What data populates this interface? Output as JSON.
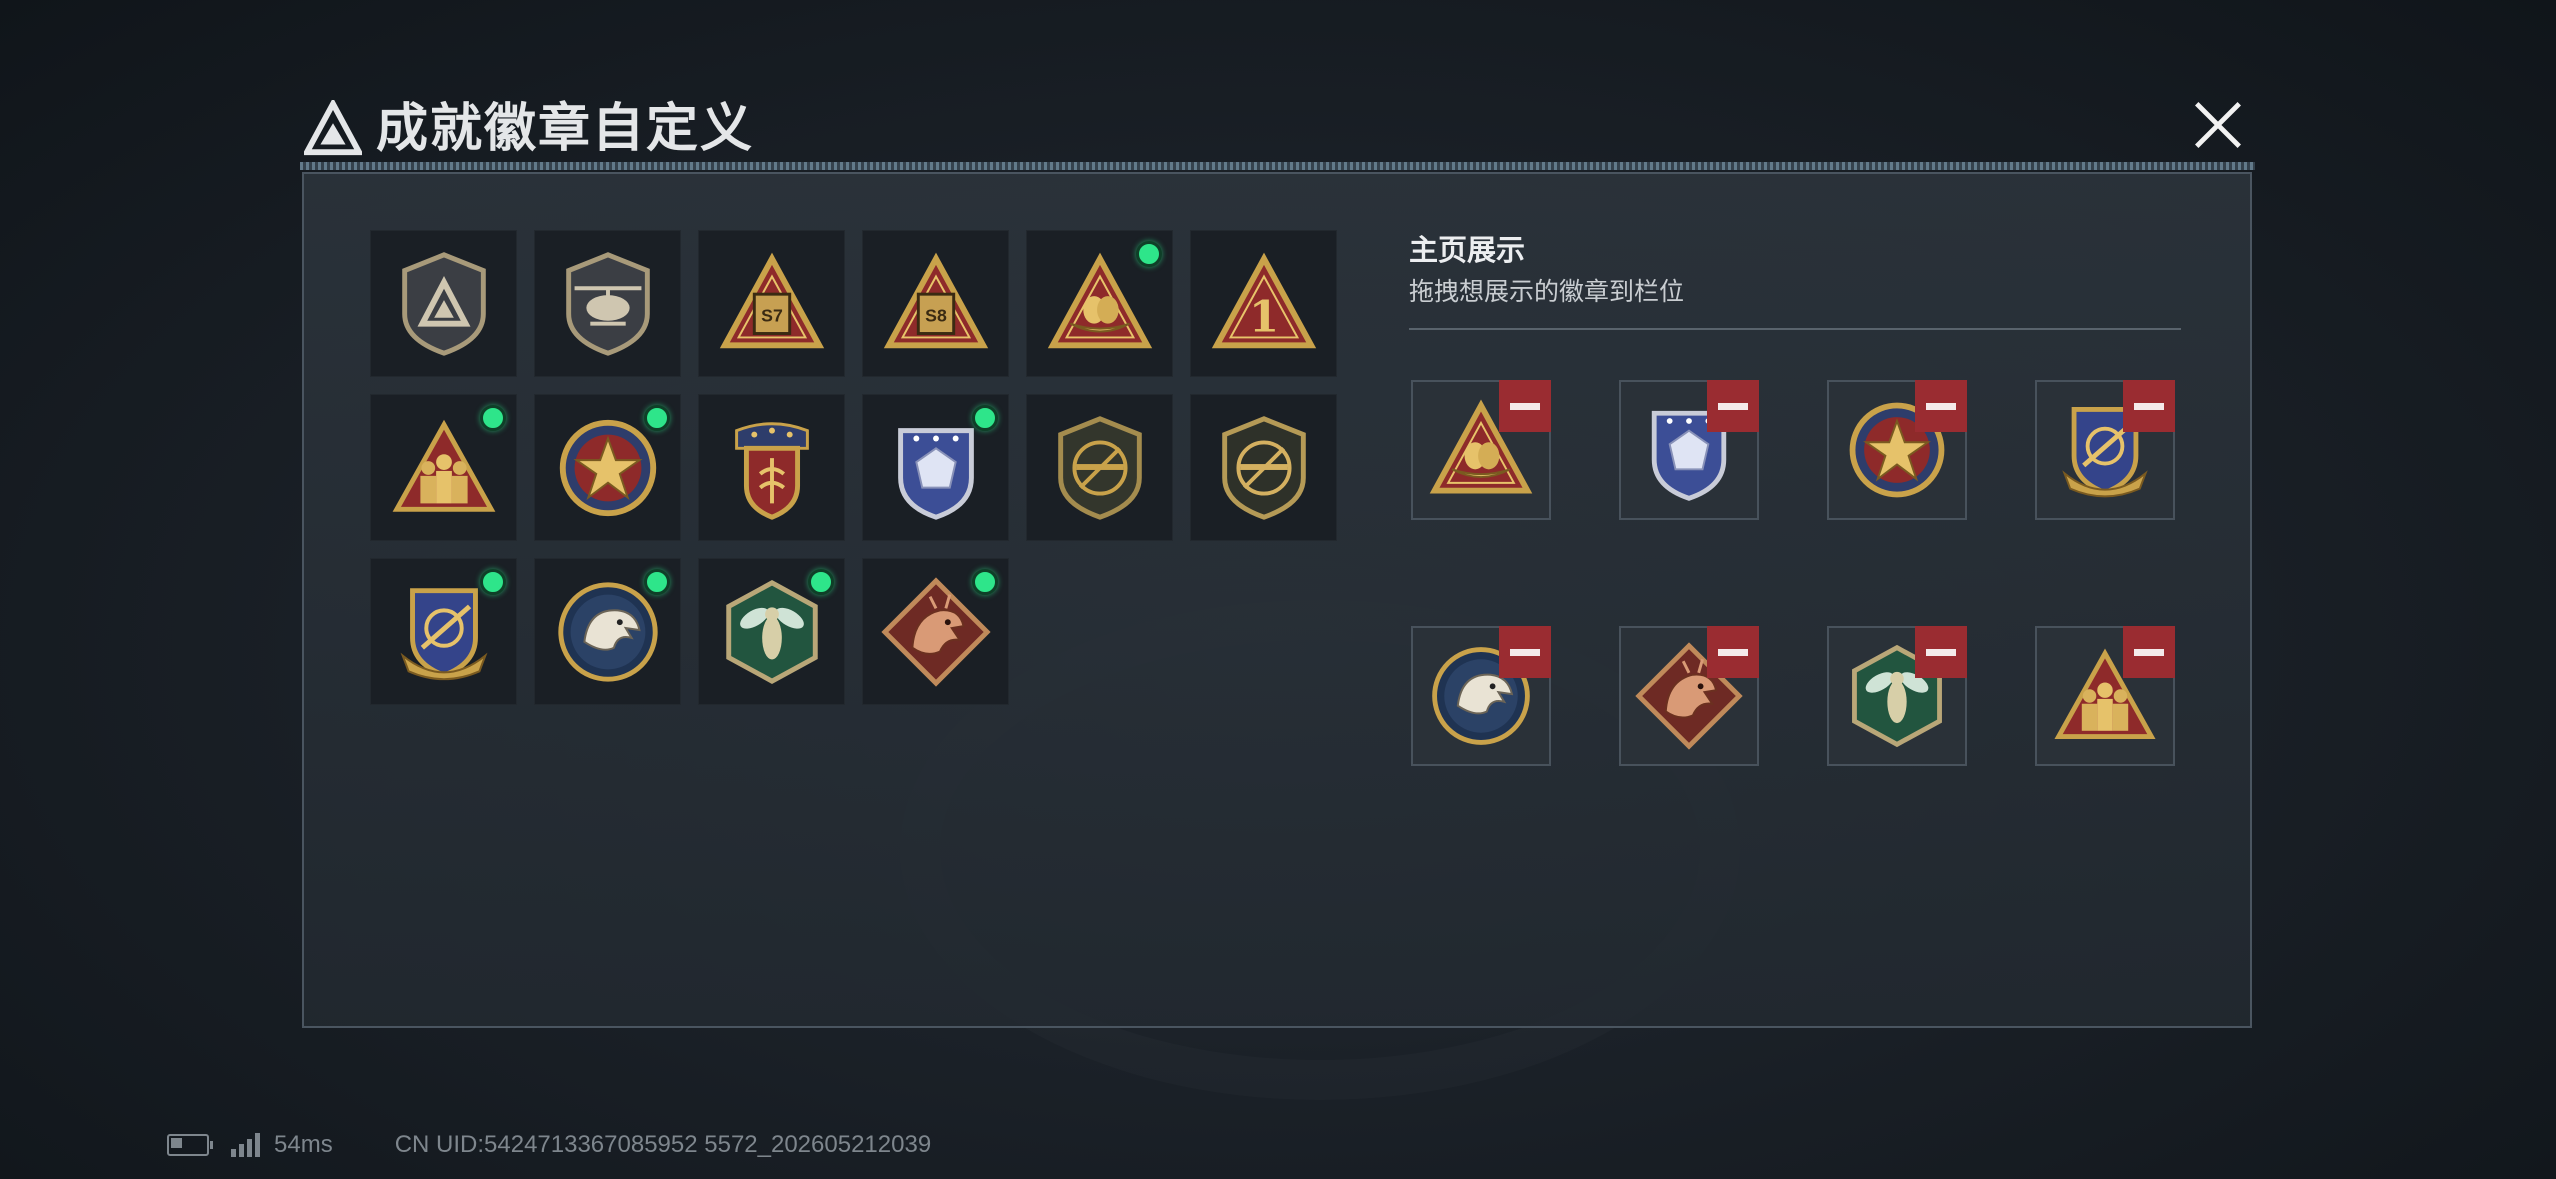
{
  "header": {
    "title": "成就徽章自定义"
  },
  "showcase": {
    "title": "主页展示",
    "subtitle": "拖拽想展示的徽章到栏位"
  },
  "badges": [
    {
      "icon": "shield-delta-badge-icon",
      "new": false
    },
    {
      "icon": "helicopter-badge-icon",
      "new": false
    },
    {
      "icon": "s7-season-badge-icon",
      "new": false
    },
    {
      "icon": "s8-season-badge-icon",
      "new": false
    },
    {
      "icon": "nest-egg-badge-icon",
      "new": true
    },
    {
      "icon": "number-one-badge-icon",
      "new": false
    },
    {
      "icon": "squad-soldiers-badge-icon",
      "new": true
    },
    {
      "icon": "star-medal-badge-icon",
      "new": true
    },
    {
      "icon": "laurel-crest-badge-icon",
      "new": false
    },
    {
      "icon": "blue-crystal-shield-badge-icon",
      "new": true
    },
    {
      "icon": "no-rifle-shield-badge-icon",
      "new": false
    },
    {
      "icon": "no-rifle-shield-gold-badge-icon",
      "new": false
    },
    {
      "icon": "sniper-crest-badge-icon",
      "new": true
    },
    {
      "icon": "eagle-roundel-badge-icon",
      "new": true
    },
    {
      "icon": "hornet-hexagon-badge-icon",
      "new": true
    },
    {
      "icon": "dragon-diamond-badge-icon",
      "new": true
    }
  ],
  "slots": [
    {
      "icon": "nest-egg-badge-icon"
    },
    {
      "icon": "blue-crystal-shield-badge-icon"
    },
    {
      "icon": "star-medal-badge-icon"
    },
    {
      "icon": "sniper-crest-badge-icon"
    },
    {
      "icon": "eagle-roundel-badge-icon"
    },
    {
      "icon": "dragon-diamond-badge-icon"
    },
    {
      "icon": "hornet-hexagon-badge-icon"
    },
    {
      "icon": "squad-soldiers-badge-icon"
    }
  ],
  "status": {
    "latency": "54ms",
    "uid": "CN UID:5424713367085952 5572_202605212039"
  },
  "colors": {
    "accent_new": "#2ee58a",
    "remove": "#9a2c31",
    "gold": "#c9a24a",
    "red": "#8e2a2a",
    "navy": "#2d3d6e"
  }
}
